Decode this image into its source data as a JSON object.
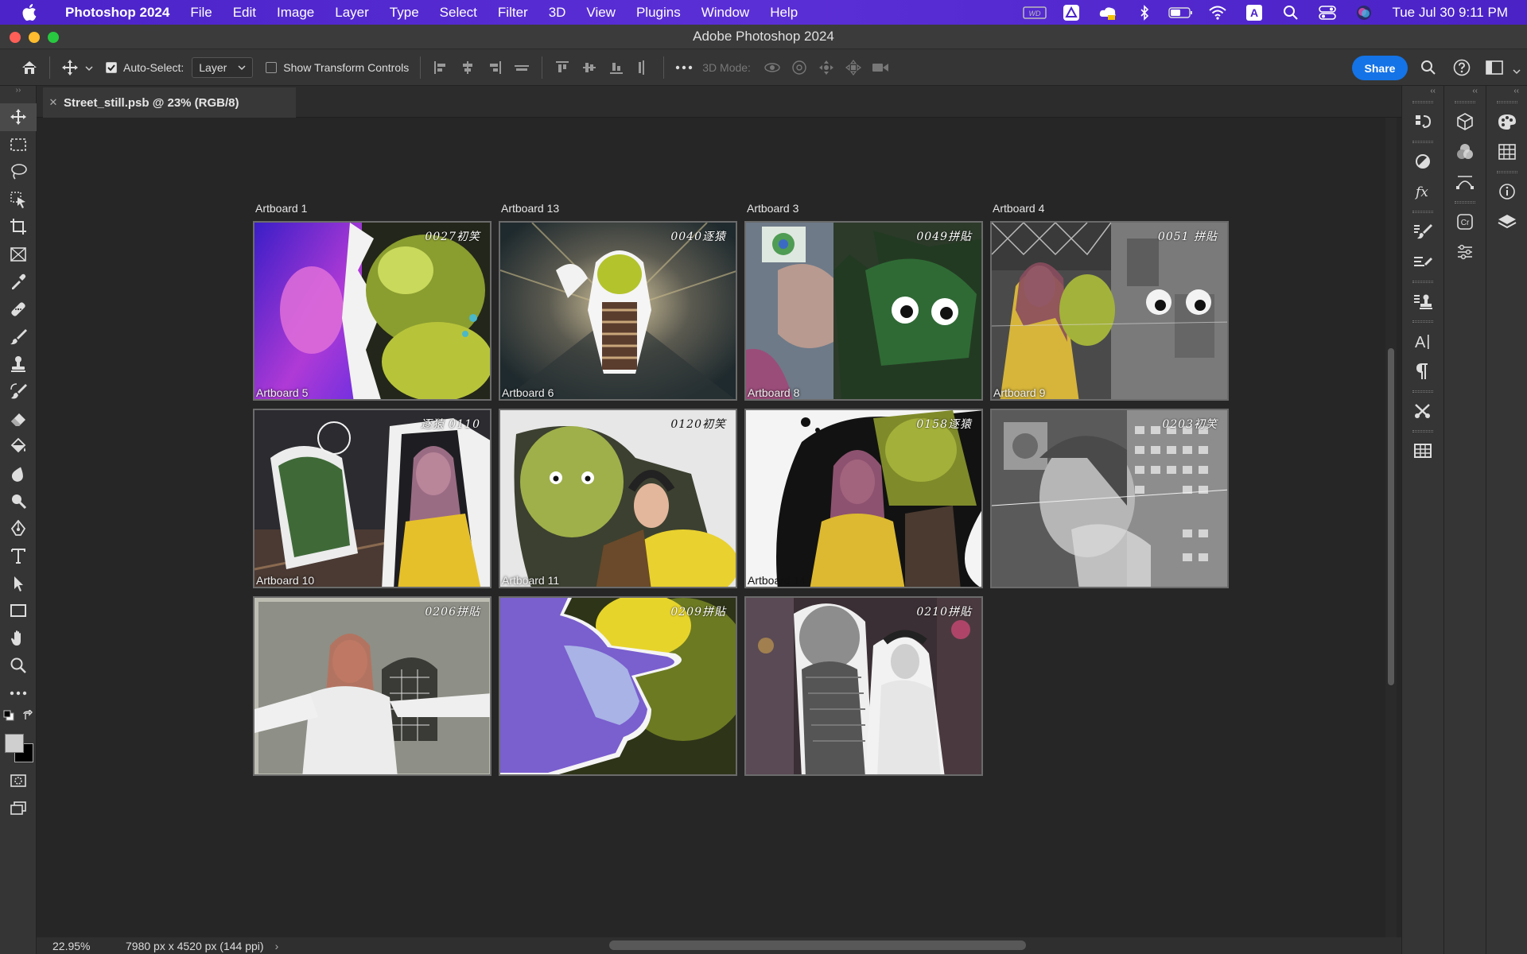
{
  "menubar": {
    "app_name": "Photoshop 2024",
    "menus": [
      "File",
      "Edit",
      "Image",
      "Layer",
      "Type",
      "Select",
      "Filter",
      "3D",
      "View",
      "Plugins",
      "Window",
      "Help"
    ],
    "clock": "Tue Jul 30  9:11 PM"
  },
  "window": {
    "title": "Adobe Photoshop 2024"
  },
  "options": {
    "auto_select_label": "Auto-Select:",
    "auto_select_value": "Layer",
    "show_transform_label": "Show Transform Controls",
    "mode_3d_label": "3D Mode:",
    "share_label": "Share"
  },
  "document": {
    "tab_title": "Street_still.psb @ 23% (RGB/8)"
  },
  "artboards": {
    "top_labels": [
      "Artboard 1",
      "Artboard 13",
      "Artboard 3",
      "Artboard 4"
    ],
    "tiles": [
      {
        "stamp": "0027初笑",
        "inner_label": "Artboard 5"
      },
      {
        "stamp": "0040逐猿",
        "inner_label": "Artboard 6"
      },
      {
        "stamp": "0049拼貼",
        "inner_label": "Artboard 8"
      },
      {
        "stamp": "0051 拼貼",
        "inner_label": "Artboard 9"
      },
      {
        "stamp": "逐猿 0110",
        "inner_label": "Artboard 10"
      },
      {
        "stamp": "0120初笑",
        "inner_label": "Artboard 11"
      },
      {
        "stamp": "0158逐猿",
        "inner_label": "Artboard 14"
      },
      {
        "stamp": "0203初笑",
        "inner_label": ""
      },
      {
        "stamp": "0206拼貼",
        "inner_label": ""
      },
      {
        "stamp": "0209拼貼",
        "inner_label": ""
      },
      {
        "stamp": "0210拼貼",
        "inner_label": ""
      }
    ]
  },
  "status": {
    "zoom": "22.95%",
    "doc_size": "7980 px x 4520 px (144 ppi)",
    "chevron": "›"
  },
  "colors": {
    "menubar_bg": "#4b23c9",
    "share_blue": "#1473e6",
    "traffic_close": "#ff5f57",
    "traffic_min": "#febc2e",
    "traffic_max": "#28c840"
  }
}
